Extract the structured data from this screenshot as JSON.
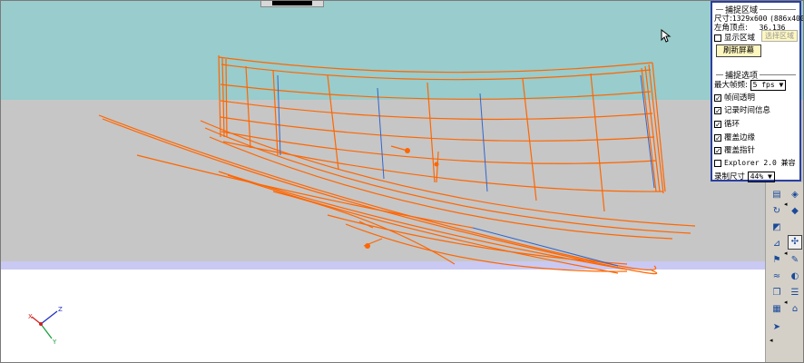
{
  "capture_panel": {
    "region_group_title": "捕捉区域",
    "size_label": "尺寸:",
    "size_value": "1329x600",
    "size_extra": "(886x400)",
    "top_left_label": "左角顶点:",
    "top_left_value": "36,136",
    "show_region_label": "显示区域",
    "show_region_checked": false,
    "select_region_button": "选择区域",
    "refresh_button": "刷新屏幕",
    "options_group_title": "捕捉选项",
    "max_fps_label": "最大帧频:",
    "max_fps_value": "5 fps",
    "options": [
      {
        "label": "帧间透明",
        "checked": true
      },
      {
        "label": "记录时间信息",
        "checked": true
      },
      {
        "label": "循环",
        "checked": true
      },
      {
        "label": "覆盖边缘",
        "checked": true
      },
      {
        "label": "覆盖指针",
        "checked": true
      },
      {
        "label": "Explorer 2.0 兼容",
        "checked": false
      }
    ],
    "record_size_label": "录制尺寸",
    "record_size_value": "44%"
  },
  "axes_gizmo": {
    "z": "Z",
    "x": "X",
    "y": "Y"
  },
  "colors": {
    "sky": "#99cccc",
    "ground": "#c6c6c6",
    "horizon": "#c9c9f4",
    "wireframe": "#ff6600",
    "wireframe_blue": "#3366cc",
    "panel_border": "#2a3fa0"
  },
  "toolbar_icons": [
    "view-icon",
    "layers-icon",
    "rotate-icon",
    "cube-icon",
    "eraser-icon",
    "select-point-icon",
    "measure-icon",
    "flag-icon",
    "wave-icon",
    "paint-icon",
    "copy-icon",
    "pen-icon",
    "stack-icon",
    "grid-icon",
    "tag-icon",
    "arrow-icon"
  ]
}
